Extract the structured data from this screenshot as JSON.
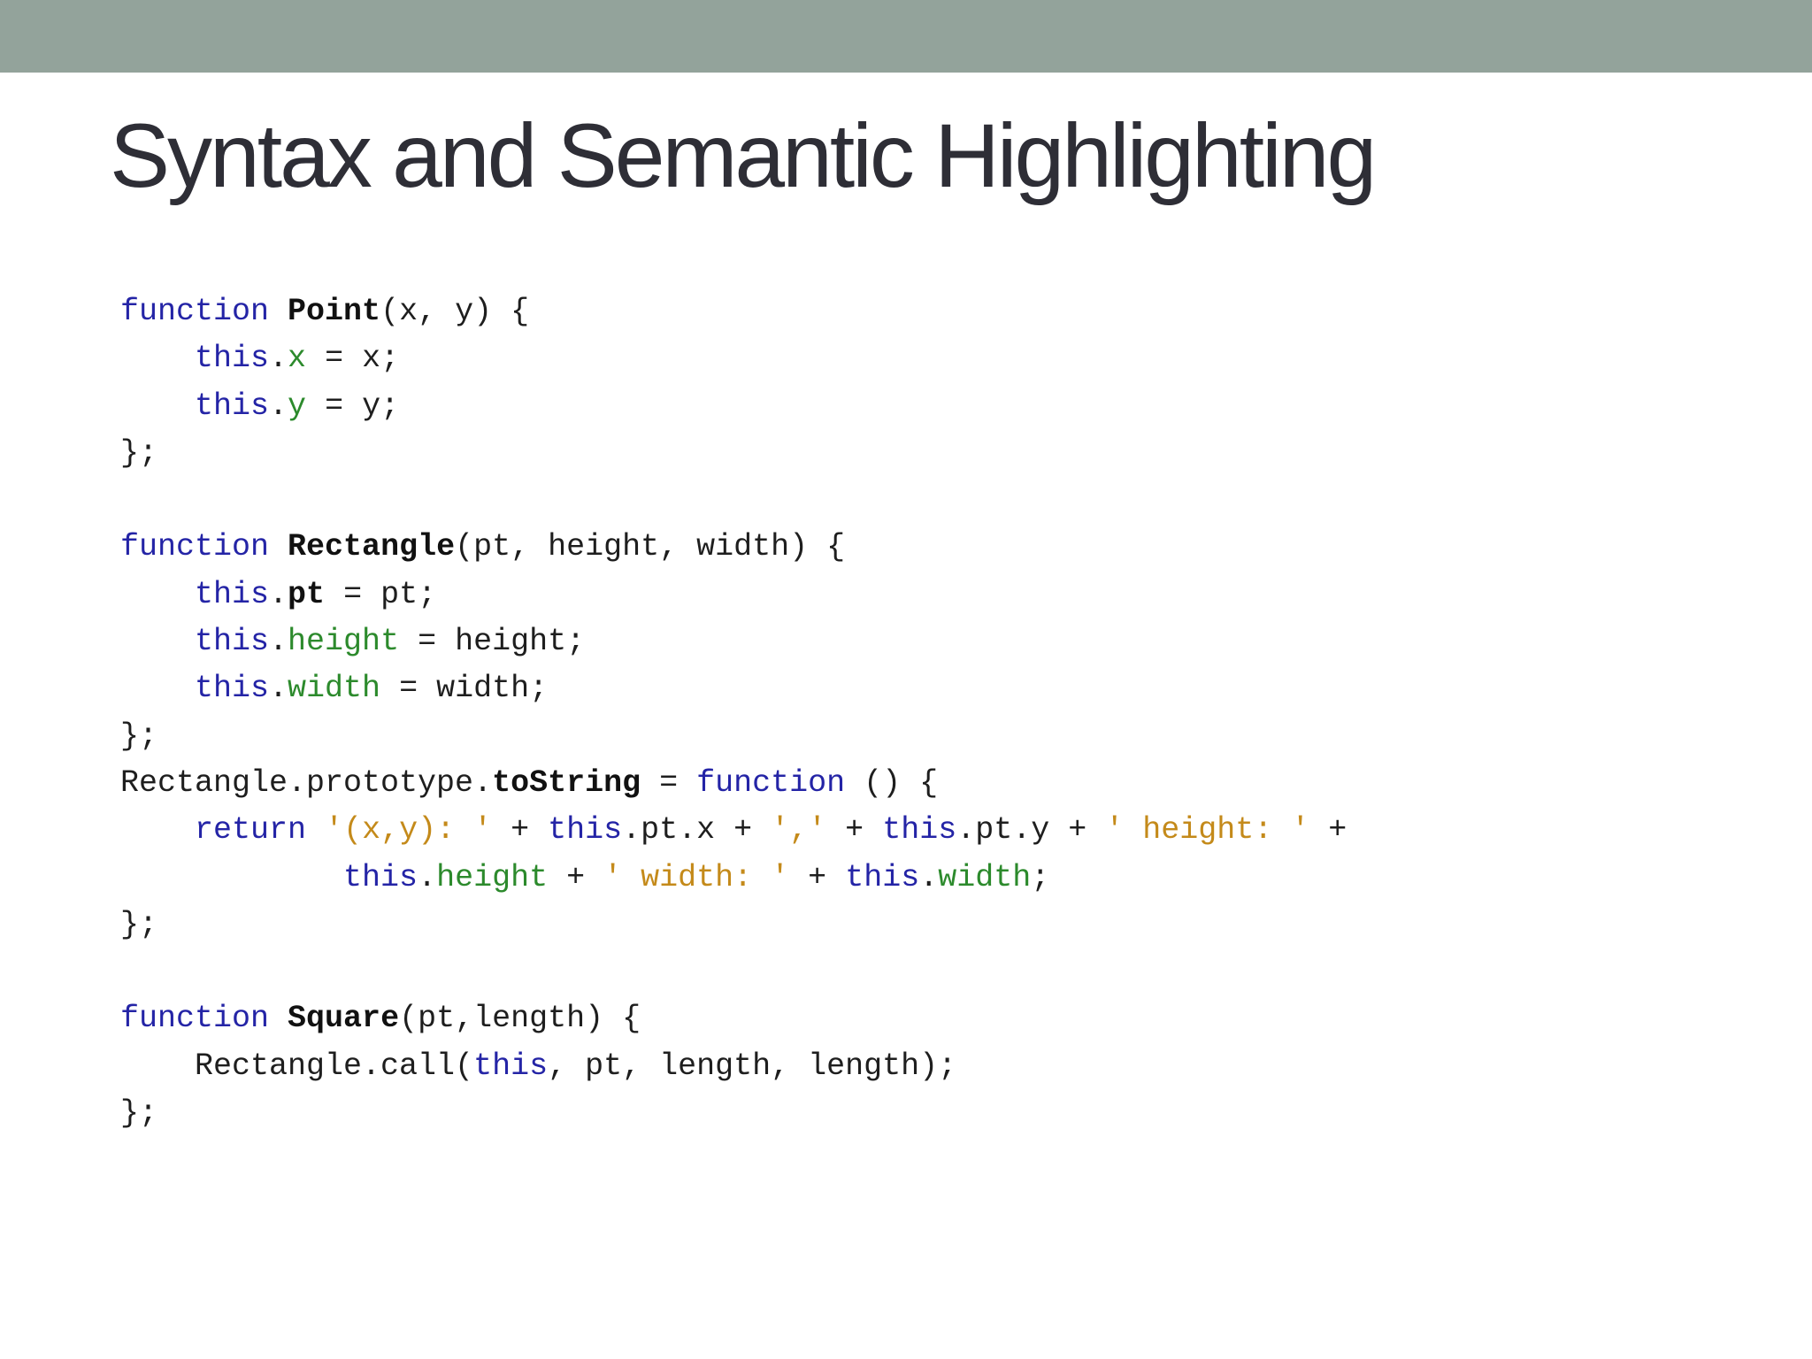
{
  "slide": {
    "title": "Syntax and Semantic Highlighting"
  },
  "colors": {
    "header_bar": "#93a39b",
    "keyword": "#2424a6",
    "property": "#2c8a2c",
    "string": "#c48a1a",
    "plain": "#1e1e1e"
  },
  "code_lines": [
    [
      {
        "t": "function",
        "c": "kw"
      },
      {
        "t": " ",
        "c": "plain"
      },
      {
        "t": "Point",
        "c": "bold"
      },
      {
        "t": "(x, y) {",
        "c": "plain"
      }
    ],
    [
      {
        "t": "    ",
        "c": "plain"
      },
      {
        "t": "this",
        "c": "kw"
      },
      {
        "t": ".",
        "c": "plain"
      },
      {
        "t": "x",
        "c": "prop"
      },
      {
        "t": " = x;",
        "c": "plain"
      }
    ],
    [
      {
        "t": "    ",
        "c": "plain"
      },
      {
        "t": "this",
        "c": "kw"
      },
      {
        "t": ".",
        "c": "plain"
      },
      {
        "t": "y",
        "c": "prop"
      },
      {
        "t": " = y;",
        "c": "plain"
      }
    ],
    [
      {
        "t": "};",
        "c": "plain"
      }
    ],
    [],
    [
      {
        "t": "function",
        "c": "kw"
      },
      {
        "t": " ",
        "c": "plain"
      },
      {
        "t": "Rectangle",
        "c": "bold"
      },
      {
        "t": "(pt, height, width) {",
        "c": "plain"
      }
    ],
    [
      {
        "t": "    ",
        "c": "plain"
      },
      {
        "t": "this",
        "c": "kw"
      },
      {
        "t": ".",
        "c": "plain"
      },
      {
        "t": "pt",
        "c": "bold"
      },
      {
        "t": " = pt;",
        "c": "plain"
      }
    ],
    [
      {
        "t": "    ",
        "c": "plain"
      },
      {
        "t": "this",
        "c": "kw"
      },
      {
        "t": ".",
        "c": "plain"
      },
      {
        "t": "height",
        "c": "prop"
      },
      {
        "t": " = height;",
        "c": "plain"
      }
    ],
    [
      {
        "t": "    ",
        "c": "plain"
      },
      {
        "t": "this",
        "c": "kw"
      },
      {
        "t": ".",
        "c": "plain"
      },
      {
        "t": "width",
        "c": "prop"
      },
      {
        "t": " = width;",
        "c": "plain"
      }
    ],
    [
      {
        "t": "};",
        "c": "plain"
      }
    ],
    [
      {
        "t": "Rectangle.prototype.",
        "c": "plain"
      },
      {
        "t": "toString",
        "c": "bold"
      },
      {
        "t": " = ",
        "c": "plain"
      },
      {
        "t": "function",
        "c": "kw"
      },
      {
        "t": " () {",
        "c": "plain"
      }
    ],
    [
      {
        "t": "    ",
        "c": "plain"
      },
      {
        "t": "return",
        "c": "kw"
      },
      {
        "t": " ",
        "c": "plain"
      },
      {
        "t": "'(x,y): '",
        "c": "str"
      },
      {
        "t": " + ",
        "c": "plain"
      },
      {
        "t": "this",
        "c": "kw"
      },
      {
        "t": ".pt.x + ",
        "c": "plain"
      },
      {
        "t": "','",
        "c": "str"
      },
      {
        "t": " + ",
        "c": "plain"
      },
      {
        "t": "this",
        "c": "kw"
      },
      {
        "t": ".pt.y + ",
        "c": "plain"
      },
      {
        "t": "' height: '",
        "c": "str"
      },
      {
        "t": " +",
        "c": "plain"
      }
    ],
    [
      {
        "t": "            ",
        "c": "plain"
      },
      {
        "t": "this",
        "c": "kw"
      },
      {
        "t": ".",
        "c": "plain"
      },
      {
        "t": "height",
        "c": "prop"
      },
      {
        "t": " + ",
        "c": "plain"
      },
      {
        "t": "' width: '",
        "c": "str"
      },
      {
        "t": " + ",
        "c": "plain"
      },
      {
        "t": "this",
        "c": "kw"
      },
      {
        "t": ".",
        "c": "plain"
      },
      {
        "t": "width",
        "c": "prop"
      },
      {
        "t": ";",
        "c": "plain"
      }
    ],
    [
      {
        "t": "};",
        "c": "plain"
      }
    ],
    [],
    [
      {
        "t": "function",
        "c": "kw"
      },
      {
        "t": " ",
        "c": "plain"
      },
      {
        "t": "Square",
        "c": "bold"
      },
      {
        "t": "(pt,length) {",
        "c": "plain"
      }
    ],
    [
      {
        "t": "    Rectangle.call(",
        "c": "plain"
      },
      {
        "t": "this",
        "c": "kw"
      },
      {
        "t": ", pt, length, length);",
        "c": "plain"
      }
    ],
    [
      {
        "t": "};",
        "c": "plain"
      }
    ]
  ]
}
